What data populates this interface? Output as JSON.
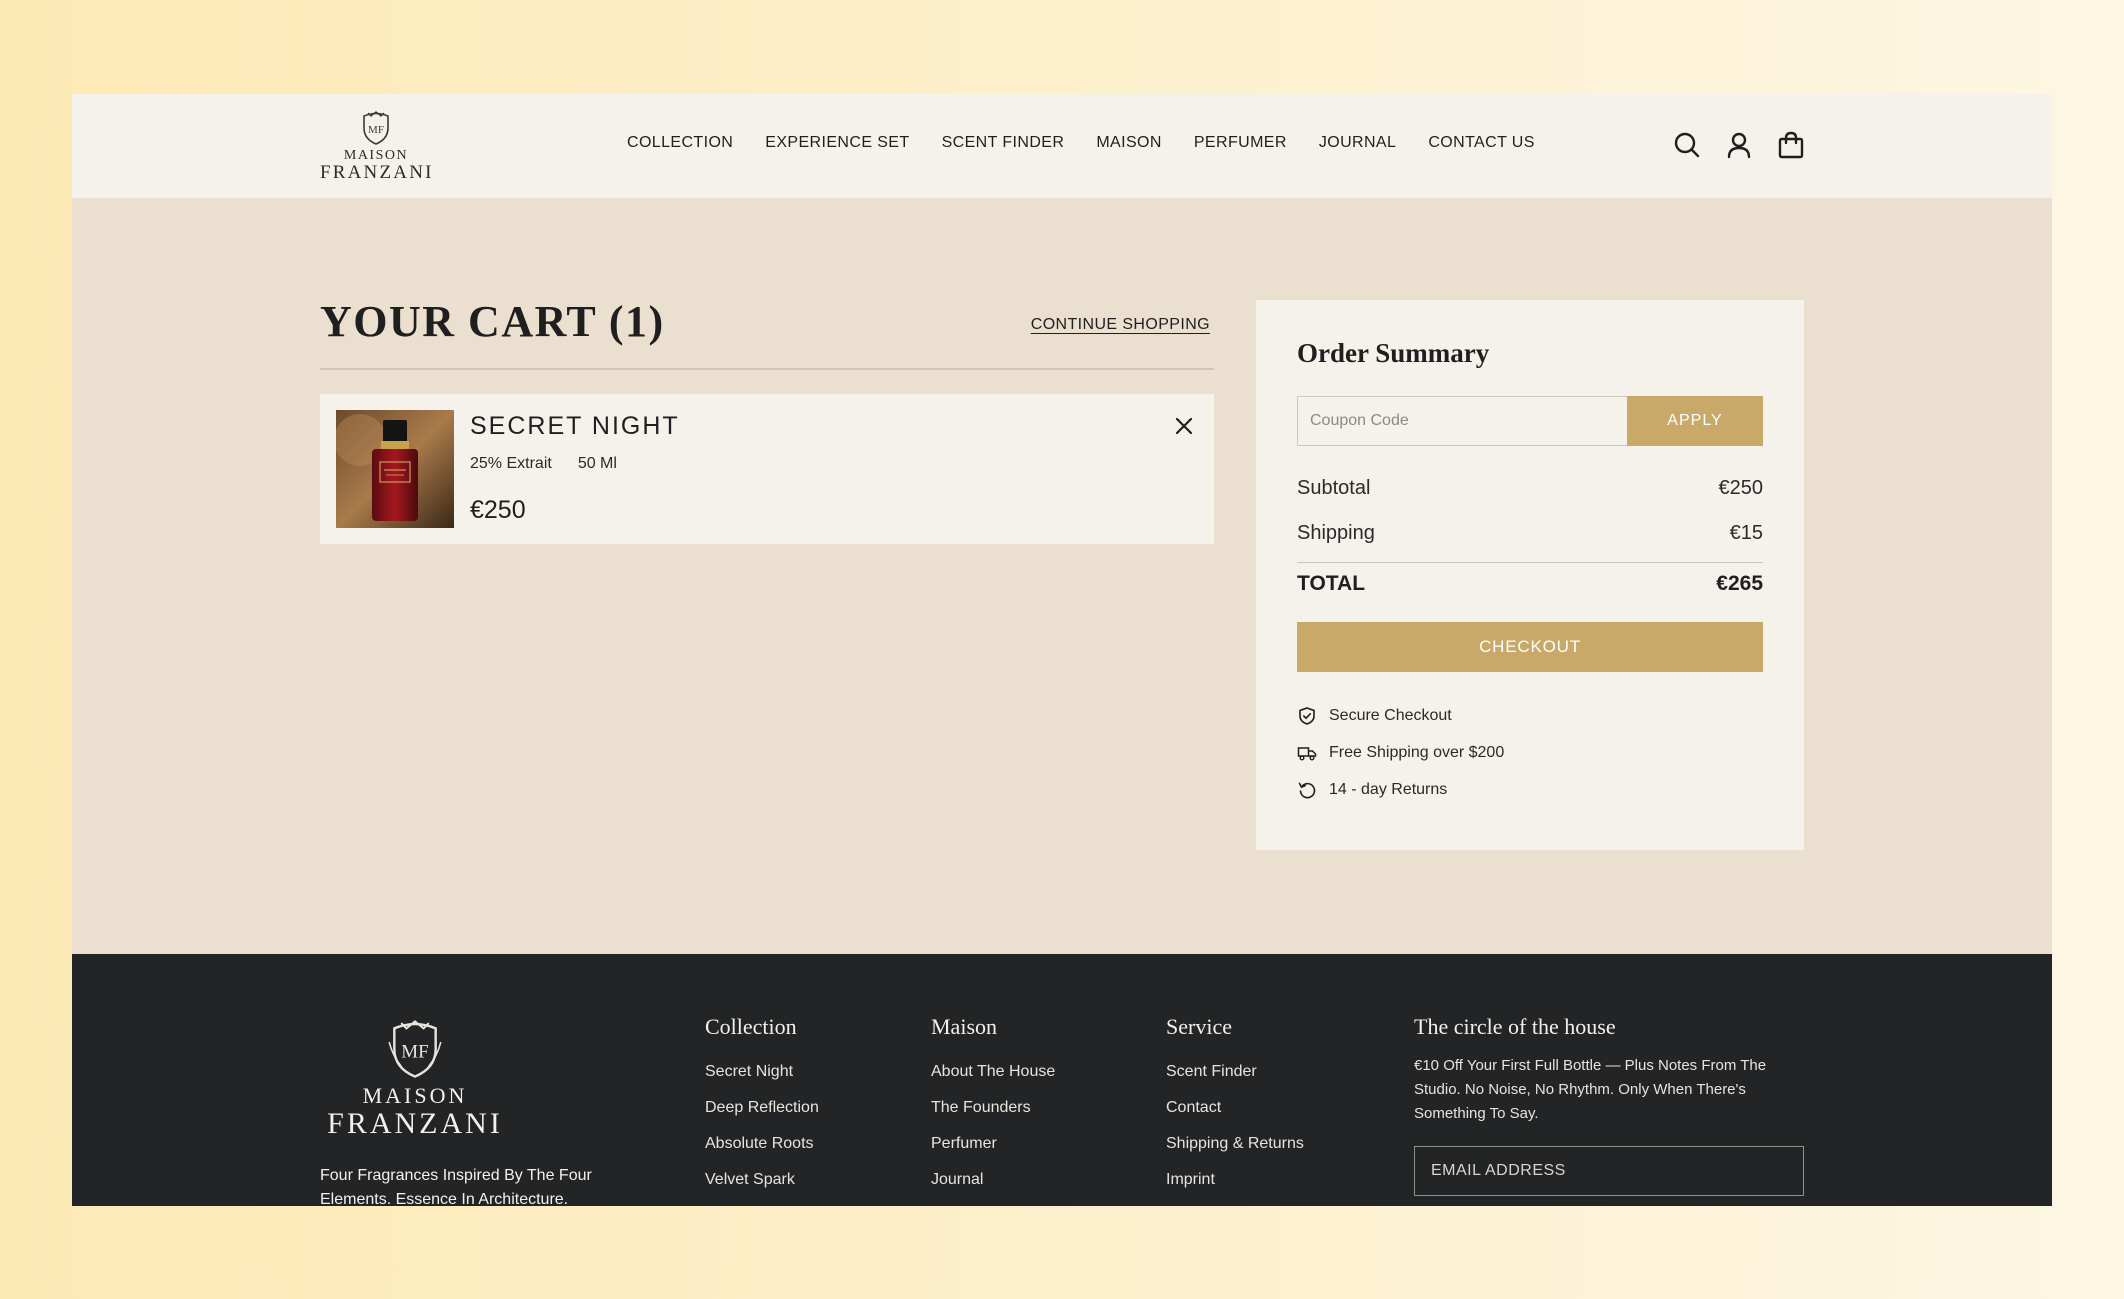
{
  "brand": {
    "name_top": "MAISON",
    "name_bottom": "FRANZANI",
    "monogram": "MF"
  },
  "nav": {
    "items": [
      {
        "label": "COLLECTION"
      },
      {
        "label": "EXPERIENCE SET"
      },
      {
        "label": "SCENT FINDER"
      },
      {
        "label": "MAISON"
      },
      {
        "label": "PERFUMER"
      },
      {
        "label": "JOURNAL"
      },
      {
        "label": "CONTACT US"
      }
    ],
    "icons": [
      "search-icon",
      "user-icon",
      "shopping-bag-icon"
    ]
  },
  "cart": {
    "title": "YOUR CART (1)",
    "continue_label": "CONTINUE SHOPPING",
    "items": [
      {
        "name": "SECRET NIGHT",
        "concentration": "25% Extrait",
        "size": "50 Ml",
        "price": "€250"
      }
    ]
  },
  "summary": {
    "title": "Order Summary",
    "coupon_placeholder": "Coupon Code",
    "apply_label": "APPLY",
    "subtotal_label": "Subtotal",
    "subtotal_value": "€250",
    "shipping_label": "Shipping",
    "shipping_value": "€15",
    "total_label": "TOTAL",
    "total_value": "€265",
    "checkout_label": "CHECKOUT",
    "perks": [
      {
        "icon": "shield-check-icon",
        "label": "Secure Checkout"
      },
      {
        "icon": "truck-icon",
        "label": "Free Shipping over $200"
      },
      {
        "icon": "return-icon",
        "label": "14 - day Returns"
      }
    ]
  },
  "footer": {
    "tagline": "Four Fragrances Inspired By The Four Elements. Essence In Architecture.",
    "collection": {
      "title": "Collection",
      "links": [
        "Secret Night",
        "Deep Reflection",
        "Absolute Roots",
        "Velvet Spark"
      ]
    },
    "maison": {
      "title": "Maison",
      "links": [
        "About The House",
        "The Founders",
        "Perfumer",
        "Journal"
      ]
    },
    "service": {
      "title": "Service",
      "links": [
        "Scent Finder",
        "Contact",
        "Shipping & Returns",
        "Imprint"
      ]
    },
    "newsletter": {
      "title": "The circle of the house",
      "text": "€10 Off Your First Full Bottle — Plus Notes From The Studio. No Noise, No Rhythm. Only When There's Something To Say.",
      "email_placeholder": "EMAIL ADDRESS"
    }
  },
  "colors": {
    "gold": "#c8a96a",
    "footer_bg": "#222425",
    "page_bg": "#ebdfcf",
    "panel_bg": "#f5f2ec"
  }
}
